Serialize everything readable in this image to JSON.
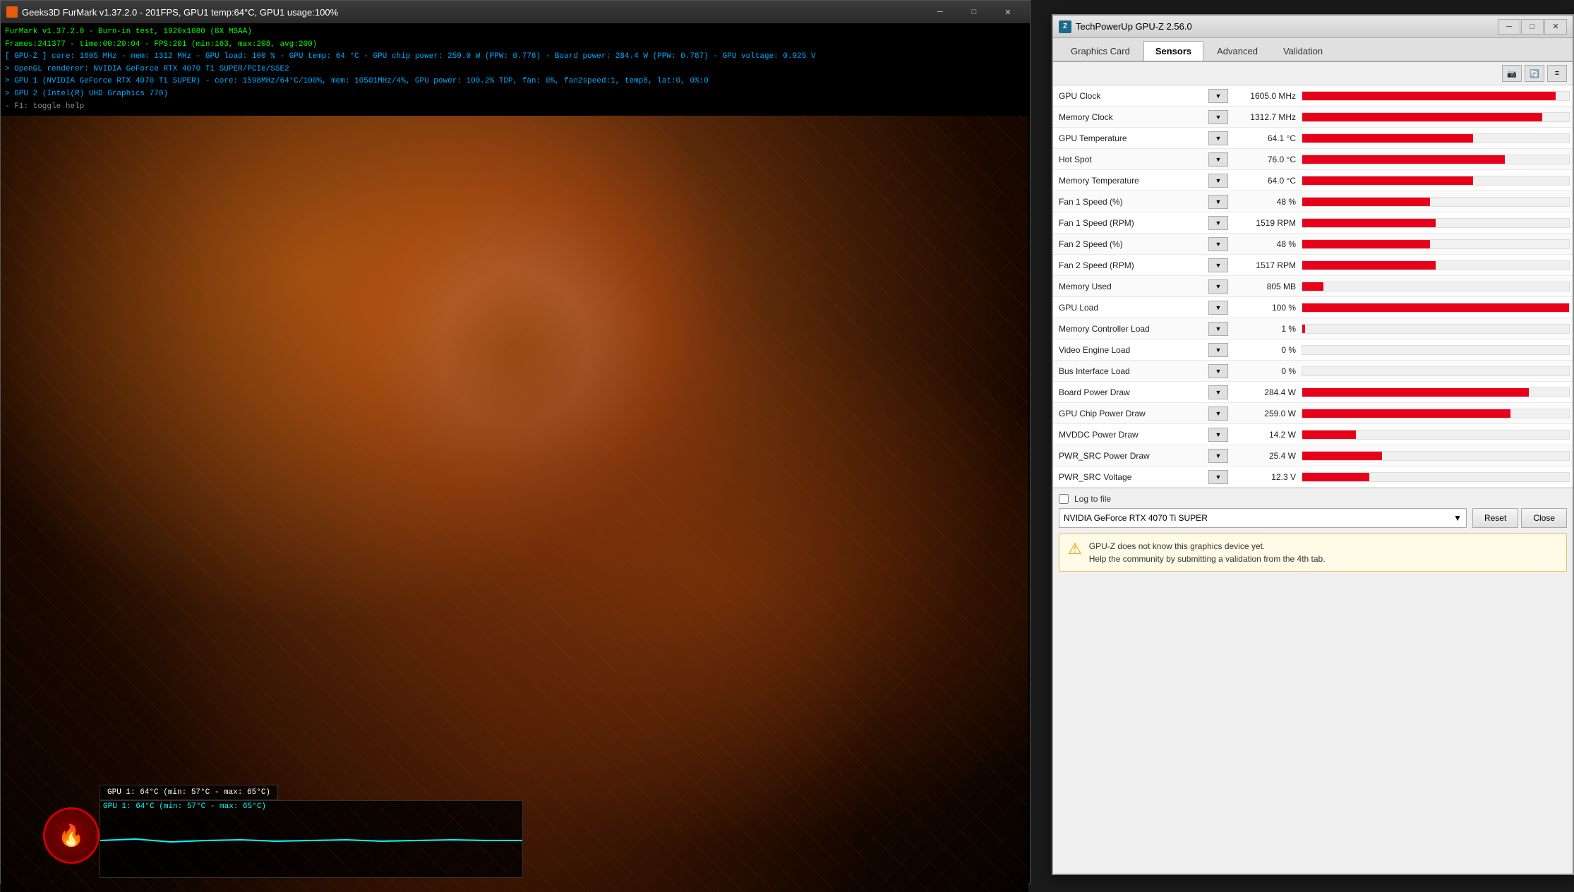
{
  "furmark": {
    "title": "Geeks3D FurMark v1.37.2.0 - 201FPS, GPU1 temp:64°C, GPU1 usage:100%",
    "icon": "🔥",
    "info_lines": [
      "FurMark v1.37.2.0 - Burn-in test, 1920x1080 (8X MSAA)",
      "Frames:241377 - time:00:20:04 - FPS:201 (min:163, max:208, avg:200)",
      "[ GPU-Z ] core: 1605 MHz - mem: 1312 MHz - GPU load: 100 % - GPU temp: 64 °C - GPU chip power: 259.0 W (PPW: 0.776) - Board power: 284.4 W (PPW: 0.787) - GPU voltage: 0.925 V",
      "> OpenGL renderer: NVIDIA GeForce RTX 4070 Ti SUPER/PCIe/SSE2",
      "> GPU 1 (NVIDIA GeForce RTX 4070 Ti SUPER) - core: 1598MHz/64°C/100%, mem: 10501MHz/4%, GPU power: 100.2% TDP, fan: 0%, fan2speed:1, temp8, lat:0, 0%:0",
      "> GPU 2 (Intel(R) UHD Graphics 770)",
      "- F1: toggle help"
    ],
    "overlay_text": "GPU 1: 64°C (min: 57°C - max: 65°C)",
    "controls": {
      "minimize": "─",
      "maximize": "□",
      "close": "✕"
    }
  },
  "gpuz": {
    "title": "TechPowerUp GPU-Z 2.56.0",
    "icon": "Z",
    "tabs": [
      "Graphics Card",
      "Sensors",
      "Advanced",
      "Validation"
    ],
    "active_tab": "Sensors",
    "toolbar_icons": [
      "📷",
      "🔄",
      "≡"
    ],
    "sensors": [
      {
        "name": "GPU Clock",
        "value": "1605.0 MHz",
        "bar_pct": 95,
        "has_bar": true
      },
      {
        "name": "Memory Clock",
        "value": "1312.7 MHz",
        "bar_pct": 90,
        "has_bar": true
      },
      {
        "name": "GPU Temperature",
        "value": "64.1 °C",
        "bar_pct": 64,
        "has_bar": true
      },
      {
        "name": "Hot Spot",
        "value": "76.0 °C",
        "bar_pct": 76,
        "has_bar": true
      },
      {
        "name": "Memory Temperature",
        "value": "64.0 °C",
        "bar_pct": 64,
        "has_bar": true
      },
      {
        "name": "Fan 1 Speed (%)",
        "value": "48 %",
        "bar_pct": 48,
        "has_bar": true
      },
      {
        "name": "Fan 1 Speed (RPM)",
        "value": "1519 RPM",
        "bar_pct": 50,
        "has_bar": true
      },
      {
        "name": "Fan 2 Speed (%)",
        "value": "48 %",
        "bar_pct": 48,
        "has_bar": true
      },
      {
        "name": "Fan 2 Speed (RPM)",
        "value": "1517 RPM",
        "bar_pct": 50,
        "has_bar": true
      },
      {
        "name": "Memory Used",
        "value": "805 MB",
        "bar_pct": 8,
        "has_bar": true
      },
      {
        "name": "GPU Load",
        "value": "100 %",
        "bar_pct": 100,
        "has_bar": true
      },
      {
        "name": "Memory Controller Load",
        "value": "1 %",
        "bar_pct": 1,
        "has_bar": true
      },
      {
        "name": "Video Engine Load",
        "value": "0 %",
        "bar_pct": 0,
        "has_bar": true
      },
      {
        "name": "Bus Interface Load",
        "value": "0 %",
        "bar_pct": 0,
        "has_bar": true
      },
      {
        "name": "Board Power Draw",
        "value": "284.4 W",
        "bar_pct": 85,
        "has_bar": true
      },
      {
        "name": "GPU Chip Power Draw",
        "value": "259.0 W",
        "bar_pct": 78,
        "has_bar": true
      },
      {
        "name": "MVDDC Power Draw",
        "value": "14.2 W",
        "bar_pct": 20,
        "has_bar": true
      },
      {
        "name": "PWR_SRC Power Draw",
        "value": "25.4 W",
        "bar_pct": 30,
        "has_bar": true
      },
      {
        "name": "PWR_SRC Voltage",
        "value": "12.3 V",
        "bar_pct": 25,
        "has_bar": true
      }
    ],
    "log_to_file_label": "Log to file",
    "device": "NVIDIA GeForce RTX 4070 Ti SUPER",
    "buttons": {
      "reset": "Reset",
      "close": "Close"
    },
    "warning": {
      "text1": "GPU-Z does not know this graphics device yet.",
      "text2": "Help the community by submitting a validation from the 4th tab."
    },
    "win_controls": {
      "minimize": "─",
      "maximize": "□",
      "close": "✕"
    }
  }
}
